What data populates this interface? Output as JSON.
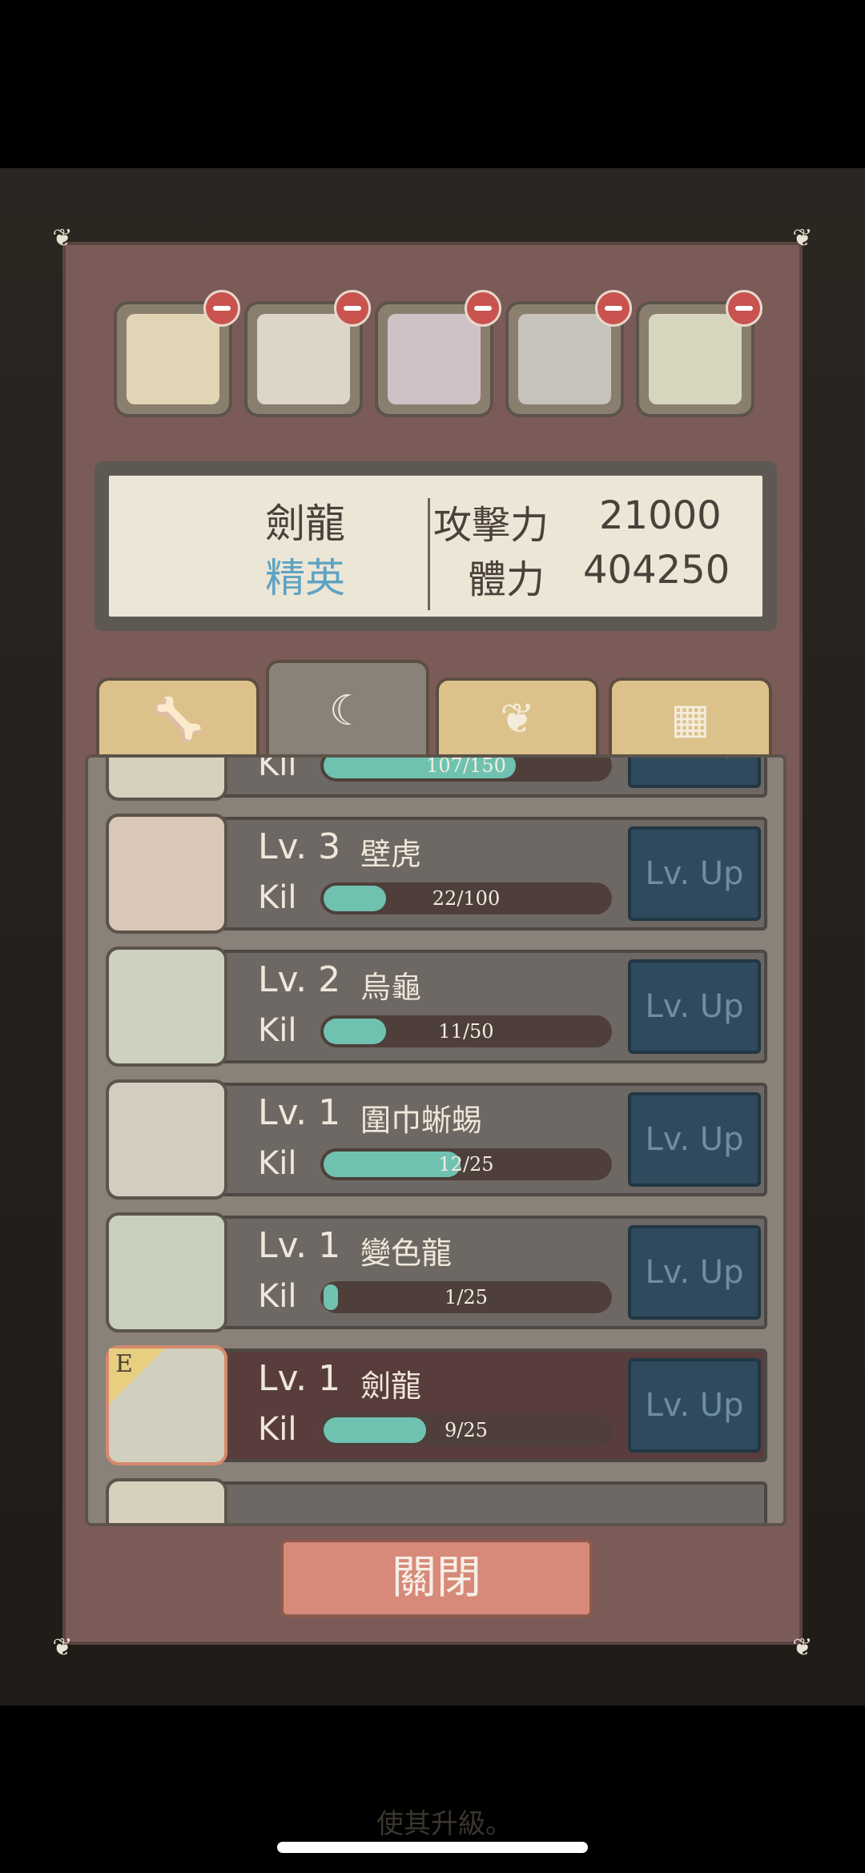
{
  "background": {
    "hint_text": "使其升級。"
  },
  "slots": [
    {
      "name": "mantis"
    },
    {
      "name": "dog"
    },
    {
      "name": "hippo"
    },
    {
      "name": "gorilla"
    },
    {
      "name": "sword-dragon"
    }
  ],
  "info": {
    "monster_name": "劍龍",
    "rank": "精英",
    "attack_label": "攻擊力",
    "attack_value": "21000",
    "hp_label": "體力",
    "hp_value": "404250"
  },
  "tabs": [
    {
      "icon": "bone-icon",
      "glyph": "🦴"
    },
    {
      "icon": "claw-icon",
      "glyph": "☾"
    },
    {
      "icon": "wing-icon",
      "glyph": "❦"
    },
    {
      "icon": "scale-icon",
      "glyph": "▦"
    }
  ],
  "list": {
    "kil_label": "Kil",
    "lvup_label": "Lv. Up",
    "partial_top_progress": "107/150",
    "rows": [
      {
        "level": "Lv. 3",
        "name": "壁虎",
        "progress": "22/100",
        "fraction": 0.22,
        "equipped": false
      },
      {
        "level": "Lv. 2",
        "name": "烏龜",
        "progress": "11/50",
        "fraction": 0.22,
        "equipped": false
      },
      {
        "level": "Lv. 1",
        "name": "圍巾蜥蜴",
        "progress": "12/25",
        "fraction": 0.48,
        "equipped": false
      },
      {
        "level": "Lv. 1",
        "name": "變色龍",
        "progress": "1/25",
        "fraction": 0.04,
        "equipped": false
      },
      {
        "level": "Lv. 1",
        "name": "劍龍",
        "progress": "9/25",
        "fraction": 0.36,
        "equipped": true,
        "badge": "E"
      }
    ]
  },
  "close_label": "關閉",
  "colors": {
    "panel": "#7b5b58",
    "accent_rank": "#5ea3c3",
    "progress_fill": "#6fc2b0",
    "button_close": "#d78a79"
  }
}
